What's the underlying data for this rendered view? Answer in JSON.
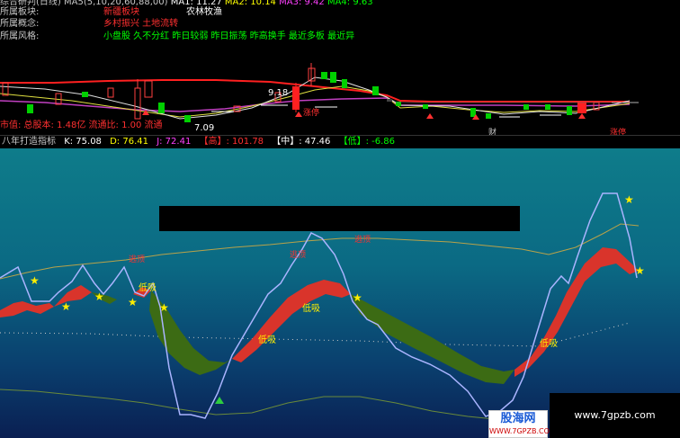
{
  "top_panel": {
    "row0": {
      "label": "综合研判(日线)",
      "ma_params": "MA5(5,10,20,60,88,00)",
      "ma1": "MA1: 11.27",
      "ma2": "MA2: 10.14",
      "ma3": "MA3: 9.42",
      "ma4": "MA4: 9.63"
    },
    "row1": {
      "label": "所属板块:",
      "value1": "新疆板块",
      "value2": "农林牧渔"
    },
    "row2": {
      "label": "所属概念:",
      "value": "乡村振兴 土地流转"
    },
    "row3": {
      "label": "所属风格:",
      "value": "小盘股 久不分红 昨日较弱 昨日振荡 昨高换手 最近多板 最近异"
    },
    "row_bottom": {
      "label": "市值: 总股本: 1.48亿  流通比: 1.00  流通"
    },
    "price_label_high": "9.18",
    "price_label_low": "7.09",
    "marker_limit_up": "涨停",
    "marker_fin": "财",
    "marker_zhang": "涨停"
  },
  "indicator_header": {
    "name": "八年打造指标",
    "k": "K: 75.08",
    "d": "D: 76.41",
    "j": "J: 72.41",
    "gao": "【高】: 101.78",
    "zhong": "【中】: 47.46",
    "di": "【低】: -6.86"
  },
  "annotations": {
    "low_suck": "低吸",
    "top_escape": "逃顶"
  },
  "badges": {
    "haiwang_title": "股海网",
    "haiwang_sub": "WWW.7GPZB.COM",
    "site": "www.7gpzb.com"
  },
  "colors": {
    "kd_up_fill": "#d9342b",
    "kd_down_fill": "#3c6b14",
    "j_line": "#aab4ff",
    "mid_line": "#b8a24a",
    "star": "#ffee00",
    "ma_red": "#ff2020",
    "ma_purple": "#c040c0",
    "ma_yellow": "#e0e040"
  },
  "icons": [
    "star-icon",
    "up-arrow-icon",
    "triangle-icon"
  ]
}
